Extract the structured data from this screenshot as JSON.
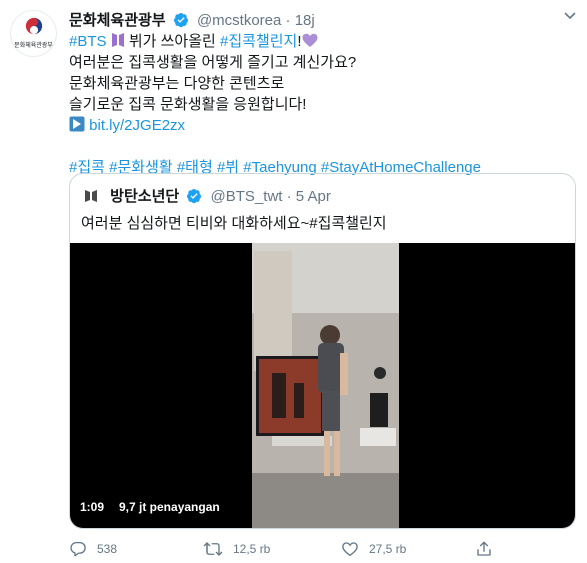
{
  "account": {
    "name": "문화체육관광부",
    "handle": "@mcstkorea",
    "separator": "·",
    "time": "18j",
    "avatar_caption": "문화체육관광부"
  },
  "tweet": {
    "line1": {
      "tag": "#BTS",
      "text": " 뷔가 쓰아올린 ",
      "tag2": "#집콕챌린지",
      "text2": "!"
    },
    "line2": "여러분은 집콕생활을 어떻게 즐기고 계신가요?",
    "line3": "문화체육관광부는 다양한 콘텐츠로",
    "line4": "슬기로운 집콕 문화생활을 응원합니다!",
    "link": "bit.ly/2JGE2zx",
    "hashtags": [
      "#집콕",
      "#문화생활",
      "#태형",
      "#뷔",
      "#Taehyung",
      "#StayAtHomeChallenge"
    ]
  },
  "quoted": {
    "name": "방탄소년단",
    "handle": "@BTS_twt",
    "separator": "·",
    "date": "5 Apr",
    "text": "여러분 심심하면 티비와 대화하세요~#집콕챌린지",
    "video": {
      "time": "1:09",
      "views": "9,7 jt penayangan"
    }
  },
  "actions": {
    "reply_count": "538",
    "retweet_count": "12,5 rb",
    "like_count": "27,5 rb"
  },
  "colors": {
    "link": "#1b95e0",
    "verified": "#1da1f2",
    "muted": "#657786",
    "border": "#ccd6dd",
    "bts_purple": "#9b6fd0"
  },
  "icons": [
    "ministry-logo-icon",
    "verified-icon",
    "caret-down-icon",
    "purple-heart-icon",
    "link-arrow-icon",
    "bts-logo-icon",
    "reply-icon",
    "retweet-icon",
    "like-icon",
    "share-icon"
  ]
}
